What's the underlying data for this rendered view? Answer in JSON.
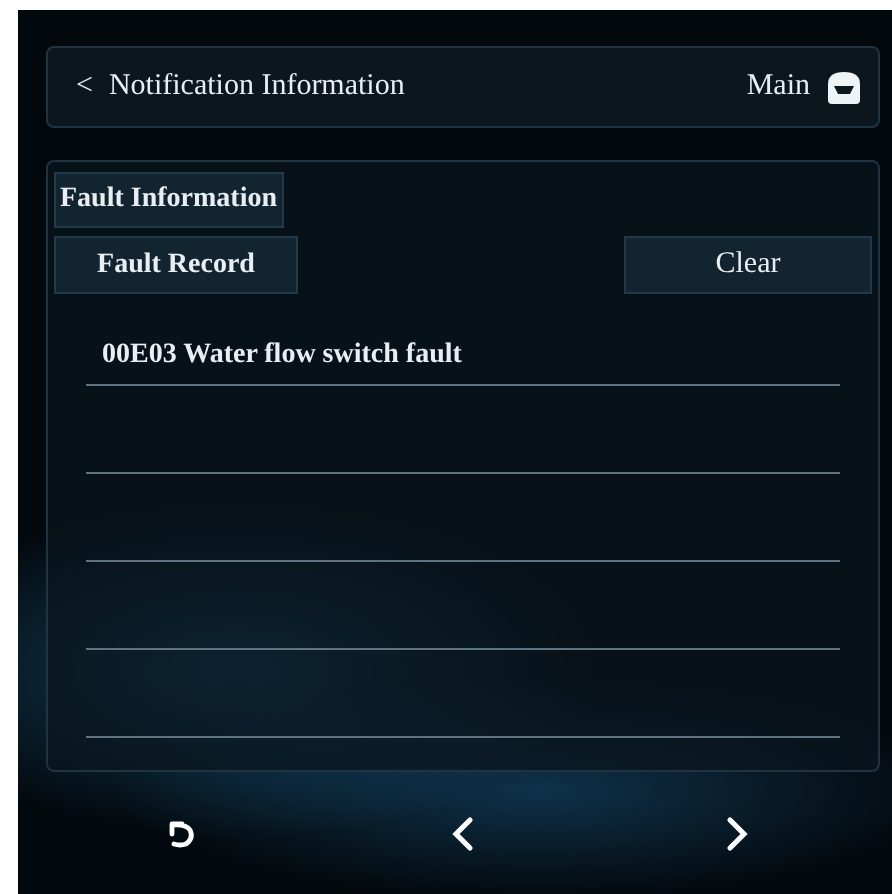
{
  "header": {
    "back": "<",
    "title": "Notification Information",
    "home_label": "Main"
  },
  "panel": {
    "section_title": "Fault Information",
    "buttons": [
      {
        "kind": "record",
        "label": "Fault Record"
      },
      {
        "kind": "clear",
        "label": "Clear"
      }
    ],
    "records": [
      "00E03 Water flow switch fault"
    ]
  }
}
